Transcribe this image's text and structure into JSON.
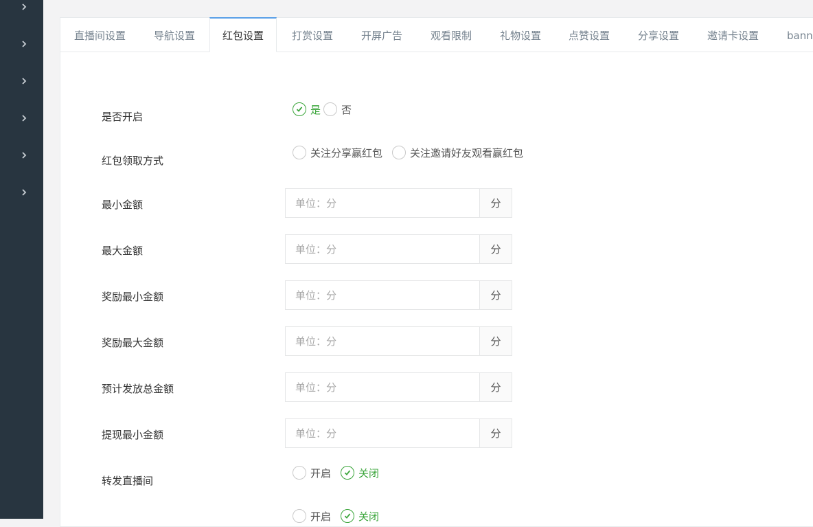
{
  "tabs": [
    {
      "label": "直播间设置"
    },
    {
      "label": "导航设置"
    },
    {
      "label": "红包设置",
      "active": true
    },
    {
      "label": "打赏设置"
    },
    {
      "label": "开屏广告"
    },
    {
      "label": "观看限制"
    },
    {
      "label": "礼物设置"
    },
    {
      "label": "点赞设置"
    },
    {
      "label": "分享设置"
    },
    {
      "label": "邀请卡设置"
    },
    {
      "label": "bann"
    }
  ],
  "form": {
    "enable": {
      "label": "是否开启",
      "options": [
        "是",
        "否"
      ],
      "selected": "是"
    },
    "method": {
      "label": "红包领取方式",
      "options": [
        "关注分享赢红包",
        "关注邀请好友观看赢红包"
      ],
      "selected": ""
    },
    "min_amount": {
      "label": "最小金额",
      "placeholder": "单位：分",
      "addon": "分"
    },
    "max_amount": {
      "label": "最大金额",
      "placeholder": "单位：分",
      "addon": "分"
    },
    "reward_min": {
      "label": "奖励最小金额",
      "placeholder": "单位：分",
      "addon": "分"
    },
    "reward_max": {
      "label": "奖励最大金额",
      "placeholder": "单位：分",
      "addon": "分"
    },
    "total_budget": {
      "label": "预计发放总金额",
      "placeholder": "单位：分",
      "addon": "分"
    },
    "withdraw_min": {
      "label": "提现最小金额",
      "placeholder": "单位：分",
      "addon": "分"
    },
    "forward": {
      "label": "转发直播间",
      "options": [
        "开启",
        "关闭"
      ],
      "selected": "关闭"
    },
    "extra": {
      "options": [
        "开启",
        "关闭"
      ],
      "selected": "关闭"
    }
  },
  "colors": {
    "accent_green": "#3aa53a",
    "sidebar": "#283540",
    "tab_border": "#5aa0e8"
  }
}
